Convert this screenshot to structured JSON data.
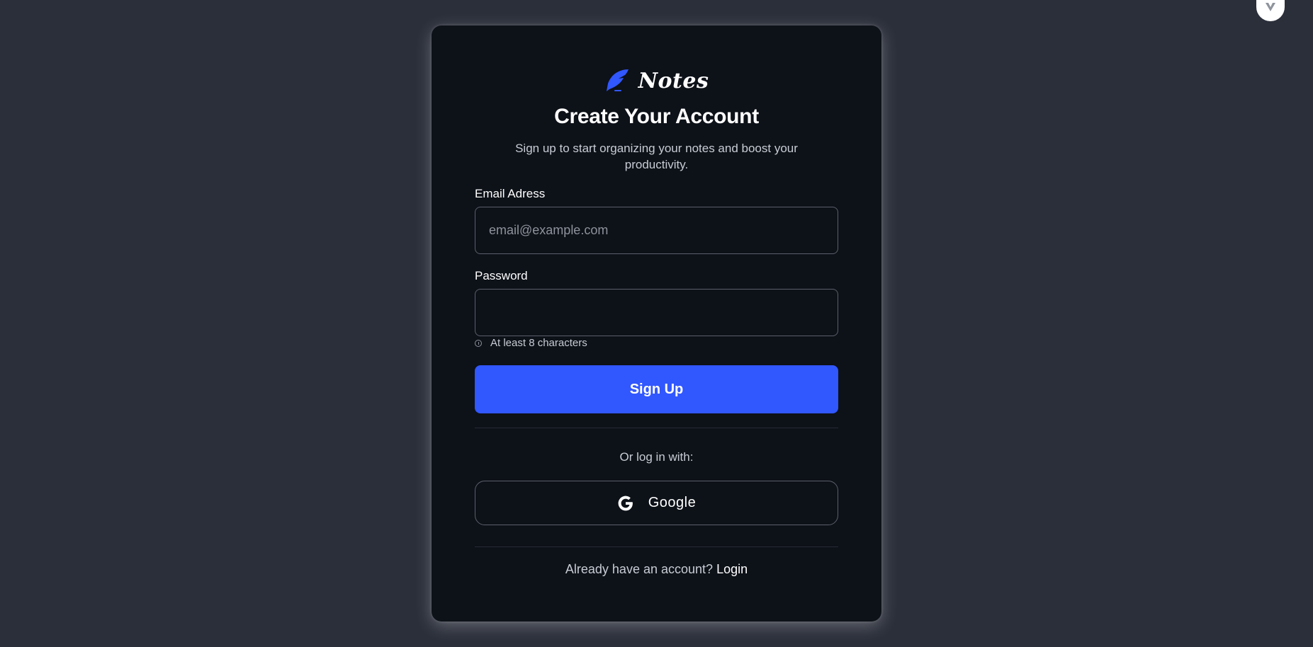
{
  "app": {
    "logo_text": "Notes"
  },
  "colors": {
    "page_bg": "#2b2f3a",
    "card_bg": "#0d1118",
    "accent": "#3157ff",
    "border": "#5b606b"
  },
  "form": {
    "title": "Create Your Account",
    "subtitle": "Sign up to start organizing your notes and boost your productivity.",
    "email_label": "Email Adress",
    "email_placeholder": "email@example.com",
    "email_value": "",
    "password_label": "Password",
    "password_value": "",
    "password_hint": "At least 8 characters",
    "submit_label": "Sign Up"
  },
  "social": {
    "or_text": "Or log in with:",
    "google_label": "Google"
  },
  "footer": {
    "already_text": "Already have an account?",
    "login_label": "Login"
  },
  "icons": {
    "logo": "feather-pen-icon",
    "hint": "info-circle-icon",
    "google": "google-g-icon",
    "corner": "chevron-down-icon"
  }
}
